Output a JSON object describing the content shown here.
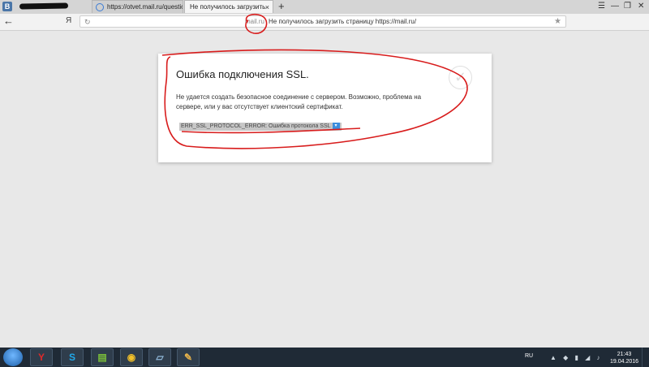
{
  "titlebar": {
    "tabs": [
      {
        "label": "https://otvet.mail.ru/question/",
        "active": false
      },
      {
        "label": "Не получилось загрузить",
        "active": true
      }
    ],
    "vk_badge": "В",
    "new_tab": "+",
    "tab_close": "×",
    "window_controls": {
      "menu": "☰",
      "minimize": "—",
      "restore": "❐",
      "close": "✕"
    }
  },
  "navbar": {
    "back": "←",
    "yandex": "Я",
    "reload": "↻",
    "domain": "mail.ru",
    "page_title": "Не получилось загрузить страницу https://mail.ru/",
    "star": "★"
  },
  "error": {
    "title": "Ошибка подключения SSL.",
    "description": "Не удается создать безопасное соединение с сервером. Возможно, проблема на сервере, или у вас отсутствует клиентский сертификат.",
    "code": "ERR_SSL_PROTOCOL_ERROR: Ошибка протокола SSL",
    "dropdown": "▾"
  },
  "taskbar": {
    "apps": [
      {
        "name": "yandex-browser",
        "glyph": "Y",
        "color": "#e02a2a"
      },
      {
        "name": "skype",
        "glyph": "S",
        "color": "#21a9ea"
      },
      {
        "name": "bluestacks",
        "glyph": "▤",
        "color": "#7bbf3a"
      },
      {
        "name": "chrome",
        "glyph": "◉",
        "color": "#f2c029"
      },
      {
        "name": "document-editor",
        "glyph": "▱",
        "color": "#8fb7d8"
      },
      {
        "name": "paint",
        "glyph": "✎",
        "color": "#e6b24a"
      }
    ],
    "language": "RU",
    "time": "21:43",
    "date": "19.04.2016"
  }
}
